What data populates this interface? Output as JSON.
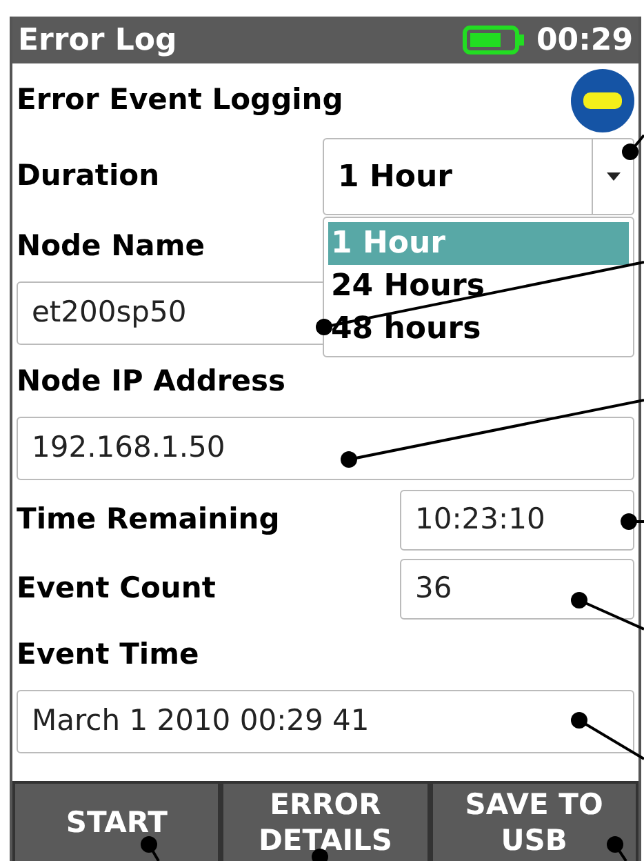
{
  "header": {
    "title": "Error Log",
    "time": "00:29"
  },
  "logging": {
    "label": "Error Event Logging"
  },
  "fields": [
    {
      "kind": "select",
      "label": "Duration",
      "value": "1 Hour",
      "expanded": true,
      "options": [
        {
          "label": "1 Hour",
          "selected": true
        },
        {
          "label": "24 Hours",
          "selected": false
        },
        {
          "label": "48 hours",
          "selected": false
        }
      ]
    },
    {
      "kind": "stacked",
      "label": "Node Name",
      "value": "et200sp50"
    },
    {
      "kind": "stacked",
      "label": "Node IP Address",
      "value": "192.168.1.50"
    },
    {
      "kind": "inline",
      "label": "Time Remaining",
      "value": "10:23:10"
    },
    {
      "kind": "inline",
      "label": "Event Count",
      "value": "36"
    },
    {
      "kind": "stacked",
      "label": "Event Time",
      "value": "March 1 2010 00:29 41"
    }
  ],
  "buttons": [
    {
      "label": "START"
    },
    {
      "label": "ERROR DETAILS"
    },
    {
      "label": "SAVE TO USB"
    }
  ]
}
